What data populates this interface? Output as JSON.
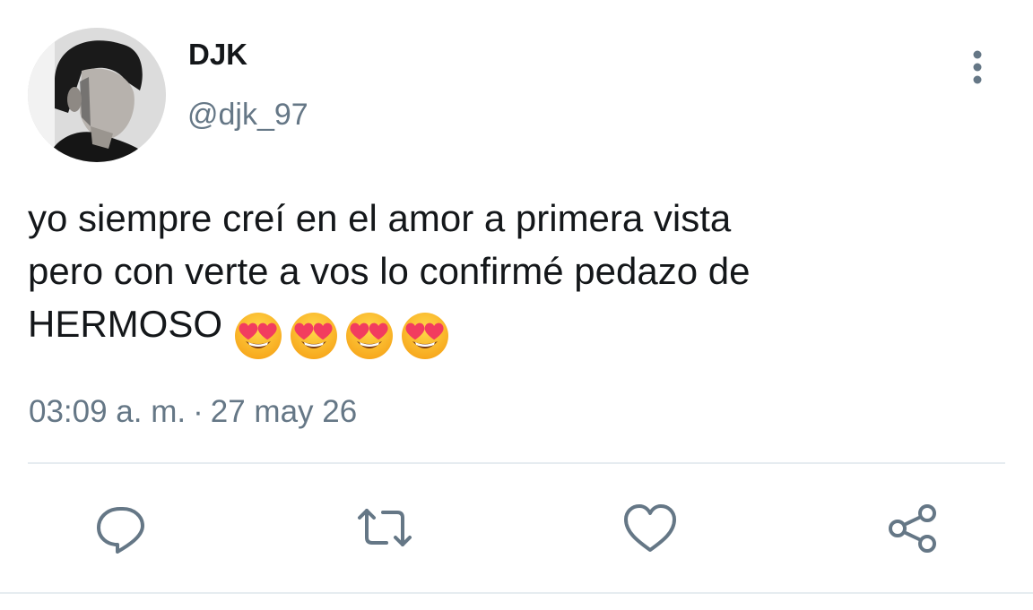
{
  "user": {
    "display_name": "DJK",
    "handle": "@djk_97",
    "avatar": "profile-photo"
  },
  "tweet": {
    "text_lines": [
      "yo siempre creí en el amor a primera vista",
      "pero con verte a vos lo confirmé pedazo de",
      "HERMOSO"
    ],
    "emoji": [
      "smiling-face-with-heart-eyes",
      "smiling-face-with-heart-eyes",
      "smiling-face-with-heart-eyes",
      "smiling-face-with-heart-eyes"
    ],
    "time": "03:09 a. m.",
    "separator": "·",
    "date": "27 may 26"
  },
  "actions": {
    "icons": [
      "reply-icon",
      "retweet-icon",
      "like-icon",
      "share-icon"
    ]
  },
  "colors": {
    "text": "#14171a",
    "secondary": "#657786",
    "divider": "#e6ecf0",
    "icon": "#657786"
  }
}
